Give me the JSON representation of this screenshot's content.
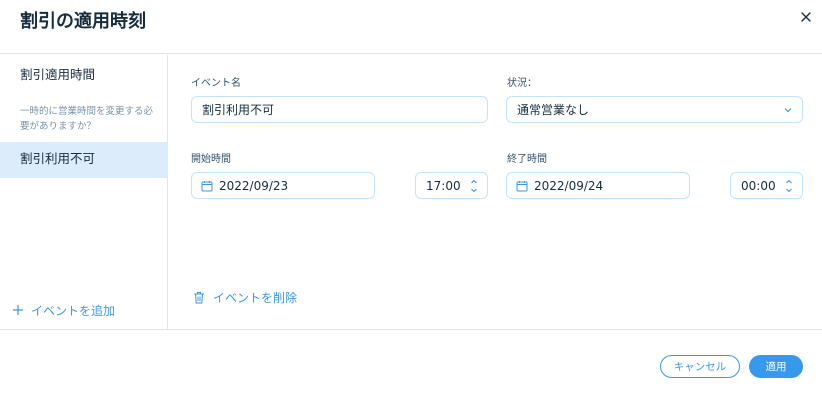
{
  "dialog": {
    "title": "割引の適用時刻",
    "close_icon": "close-icon"
  },
  "sidebar": {
    "items": [
      {
        "label": "割引適用時間"
      },
      {
        "label": "割引利用不可",
        "active": true
      }
    ],
    "question": "一時的に営業時間を変更する必要がありますか？",
    "add_event_label": "イベントを追加"
  },
  "form": {
    "event_name": {
      "label": "イベント名",
      "value": "割引利用不可"
    },
    "status": {
      "label": "状況：",
      "value": "通常営業なし"
    },
    "start": {
      "label": "開始時間",
      "date": "2022/09/23",
      "time": "17:00"
    },
    "end": {
      "label": "終了時間",
      "date": "2022/09/24",
      "time": "00:00"
    },
    "delete_label": "イベントを削除"
  },
  "footer": {
    "cancel_label": "キャンセル",
    "apply_label": "適用"
  },
  "colors": {
    "accent": "#3899ec",
    "active_bg": "#dcecfb",
    "border": "#c1e4fe"
  }
}
